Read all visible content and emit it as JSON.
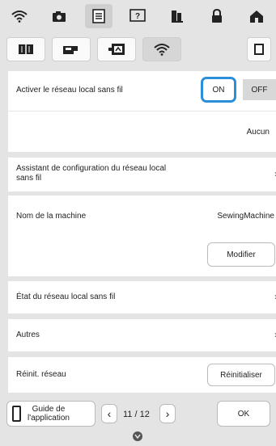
{
  "wireless_lan": {
    "enable_label": "Activer le réseau local sans fil",
    "on_label": "ON",
    "off_label": "OFF",
    "network_value": "Aucun"
  },
  "setup_wizard": {
    "label": "Assistant de configuration du réseau local sans fil"
  },
  "machine_name": {
    "label": "Nom de la machine",
    "value": "SewingMachine",
    "modify_label": "Modifier"
  },
  "status": {
    "label": "État du réseau local sans fil"
  },
  "others": {
    "label": "Autres"
  },
  "reset": {
    "label": "Réinit. réseau",
    "button_label": "Réinitialiser"
  },
  "bottom": {
    "guide_line1": "Guide de",
    "guide_line2": "l'application",
    "page": "11 / 12",
    "ok_label": "OK"
  },
  "icons": [
    "wifi-icon",
    "camera-icon",
    "settings-page-icon",
    "help-icon",
    "thread-icon",
    "lock-icon",
    "home-icon",
    "book-icon",
    "sewing-machine-icon",
    "embroidery-frame-icon",
    "wifi-icon",
    "expand-icon"
  ]
}
